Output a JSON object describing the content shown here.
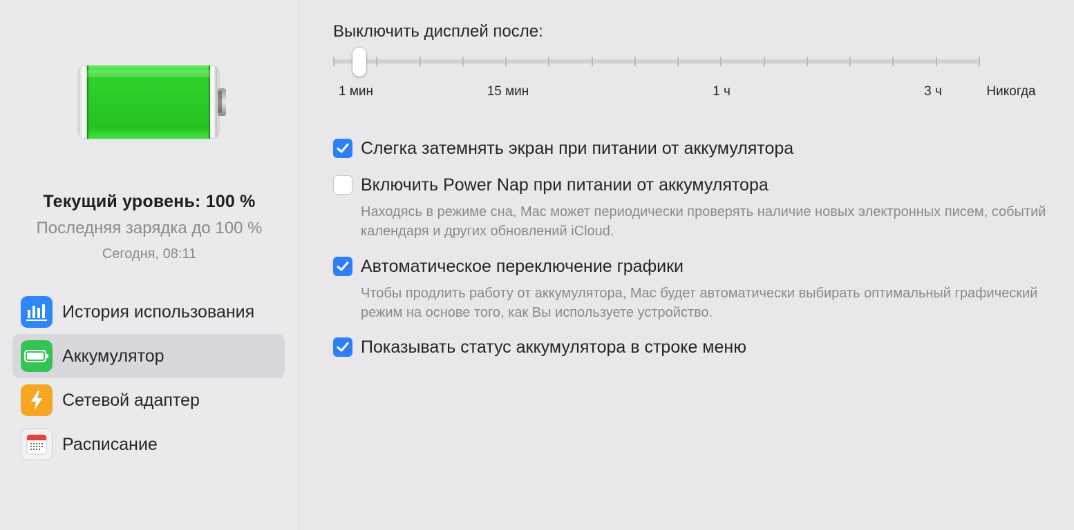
{
  "sidebar": {
    "battery": {
      "current_level": "Текущий уровень: 100 %",
      "last_charge": "Последняя зарядка до 100 %",
      "last_charge_time": "Сегодня, 08:11",
      "fill_fraction": 1.0,
      "fill_color": "#2fd22c"
    },
    "items": [
      {
        "label": "История использования",
        "icon": "bar-chart-icon",
        "color": "#2f86f5",
        "selected": false
      },
      {
        "label": "Аккумулятор",
        "icon": "battery-icon",
        "color": "#34c454",
        "selected": true
      },
      {
        "label": "Сетевой адаптер",
        "icon": "lightning-icon",
        "color": "#f5a623",
        "selected": false
      },
      {
        "label": "Расписание",
        "icon": "calendar-icon",
        "color": "#f2f2f2",
        "selected": false
      }
    ]
  },
  "main": {
    "display_off": {
      "title": "Выключить дисплей после:",
      "tick_labels": [
        "1 мин",
        "15 мин",
        "1 ч",
        "3 ч",
        "Никогда"
      ],
      "selected_value": "2 мин",
      "tick_count": 16
    },
    "options": [
      {
        "label": "Слегка затемнять экран при питании от аккумулятора",
        "checked": true,
        "description": ""
      },
      {
        "label": "Включить Power Nap при питании от аккумулятора",
        "checked": false,
        "description": "Находясь в режиме сна, Mac может периодически проверять наличие новых электронных писем, событий календаря и других обновлений iCloud."
      },
      {
        "label": "Автоматическое переключение графики",
        "checked": true,
        "description": "Чтобы продлить работу от аккумулятора, Mac будет автоматически выбирать оптимальный графический режим на основе того, как Вы используете устройство."
      },
      {
        "label": "Показывать статус аккумулятора в строке меню",
        "checked": true,
        "description": ""
      }
    ]
  },
  "colors": {
    "accent": "#2d7ff8",
    "sidebar_selected": "#d9d7db",
    "secondary_text": "#8a8a8c"
  }
}
